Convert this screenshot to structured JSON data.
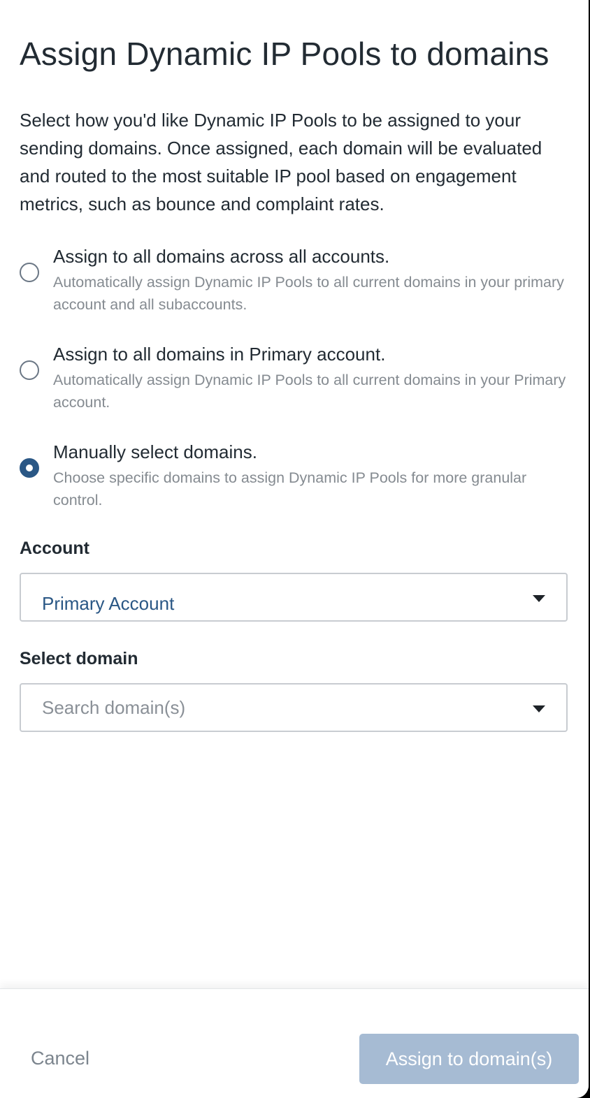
{
  "dialog": {
    "title": "Assign Dynamic IP Pools to domains",
    "description": "Select how you'd like Dynamic IP Pools to be assigned to your sending domains. Once assigned, each domain will be evaluated and routed to the most suitable IP pool based on engagement metrics, such as bounce and complaint rates."
  },
  "options": [
    {
      "label": "Assign to all domains across all accounts.",
      "sublabel": "Automatically assign Dynamic IP Pools to all current domains in your primary account and all subaccounts.",
      "selected": false
    },
    {
      "label": "Assign to all domains in Primary account.",
      "sublabel": "Automatically assign Dynamic IP Pools to all current domains in your Primary account.",
      "selected": false
    },
    {
      "label": "Manually select domains.",
      "sublabel": "Choose specific domains to assign Dynamic IP Pools for more granular control.",
      "selected": true
    }
  ],
  "account": {
    "label": "Account",
    "value": "Primary Account"
  },
  "domain": {
    "label": "Select domain",
    "placeholder": "Search domain(s)"
  },
  "footer": {
    "cancel_label": "Cancel",
    "assign_label": "Assign to domain(s)"
  },
  "colors": {
    "accent": "#2a5785",
    "button_disabled": "#a6bbd3",
    "muted_text": "#858b91"
  }
}
